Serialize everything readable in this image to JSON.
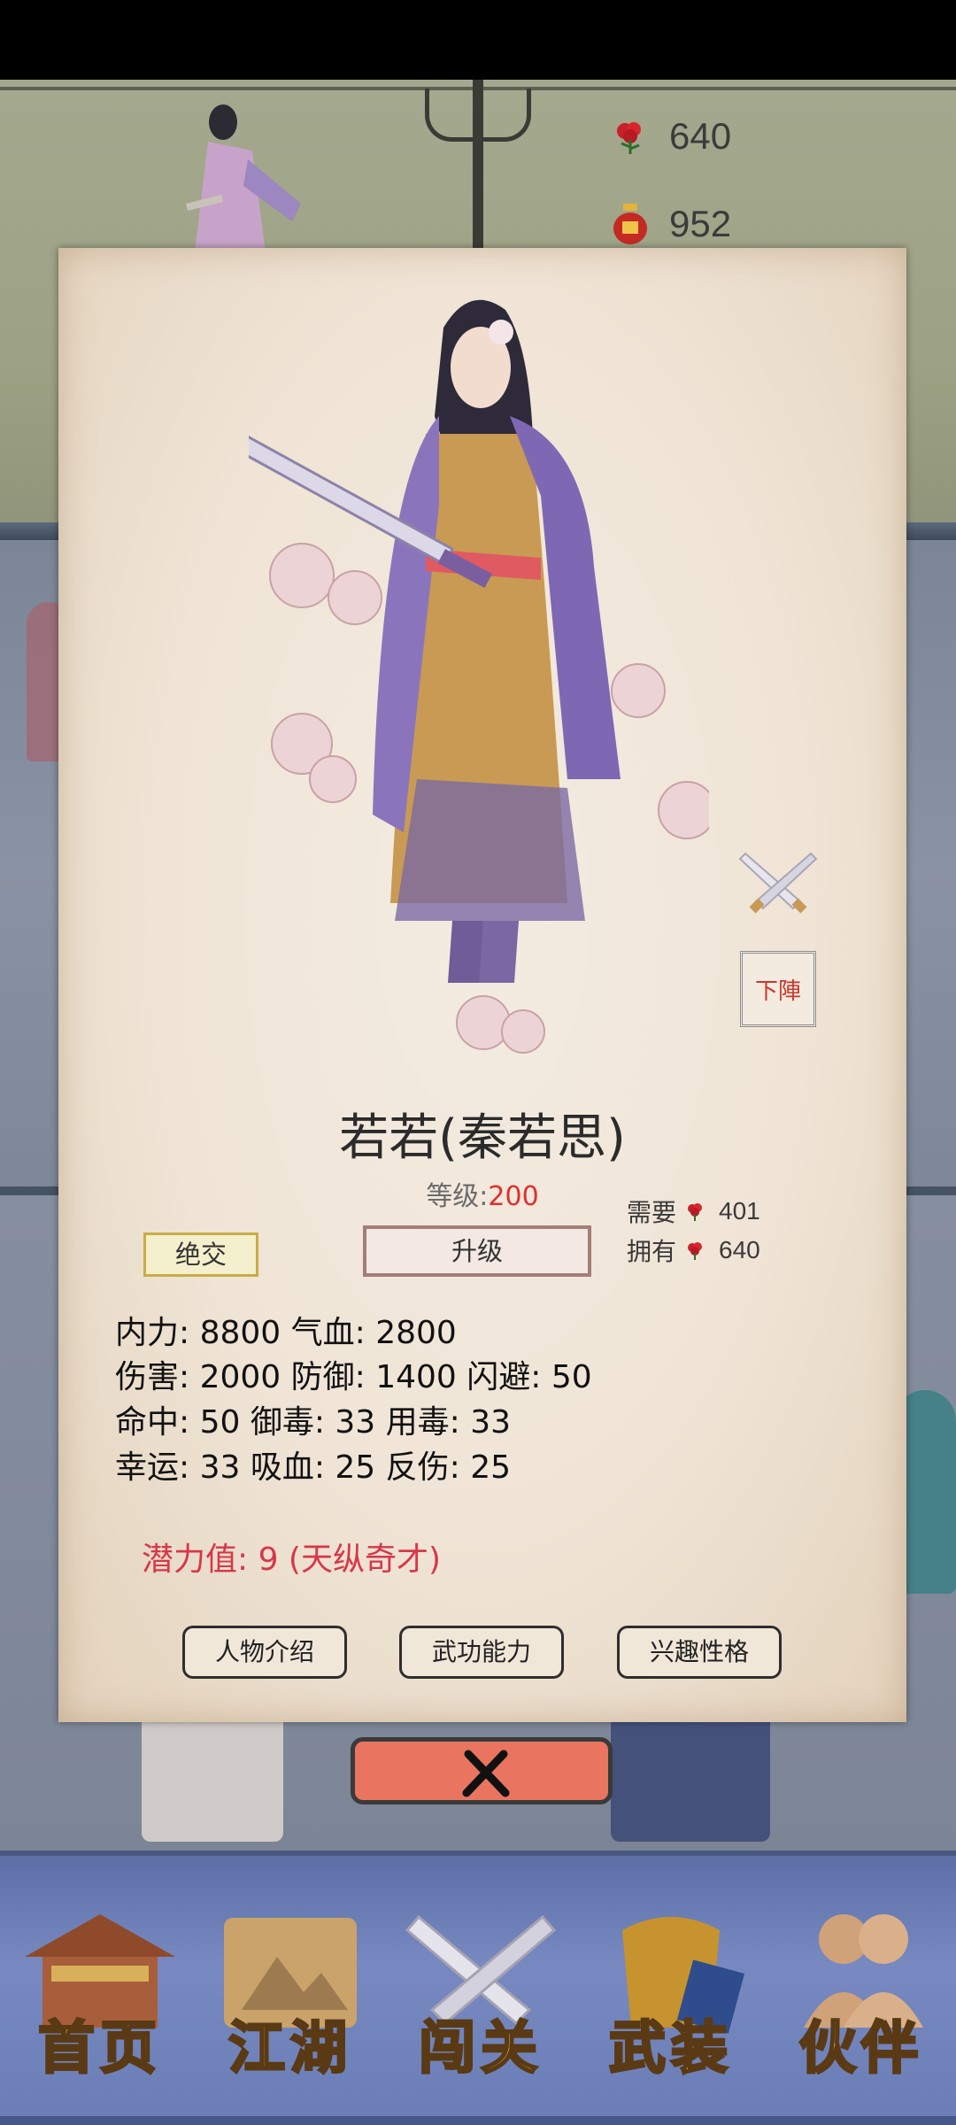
{
  "resources": {
    "flower_count": "640",
    "wine_count": "952"
  },
  "character": {
    "name": "若若(秦若思)",
    "level_label": "等级:",
    "level_value": "200"
  },
  "upgrade_cost": {
    "need_label": "需要",
    "need_value": "401",
    "have_label": "拥有",
    "have_value": "640"
  },
  "buttons": {
    "break_ties": "绝交",
    "upgrade": "升级",
    "formation": "下陣"
  },
  "stats": [
    "内力: 8800 气血: 2800",
    "伤害: 2000 防御: 1400 闪避: 50",
    "命中: 50 御毒: 33 用毒: 33",
    "幸运: 33 吸血: 25 反伤: 25"
  ],
  "potential": "潜力值: 9 (天纵奇才)",
  "tabs": [
    "人物介绍",
    "武功能力",
    "兴趣性格"
  ],
  "nav": [
    "首页",
    "江湖",
    "闯关",
    "武装",
    "伙伴"
  ],
  "colors": {
    "accent_red": "#e0302d",
    "potential_red": "#d8364a",
    "nav_blue": "#6b7db6",
    "nav_gold": "#f1c24a"
  }
}
